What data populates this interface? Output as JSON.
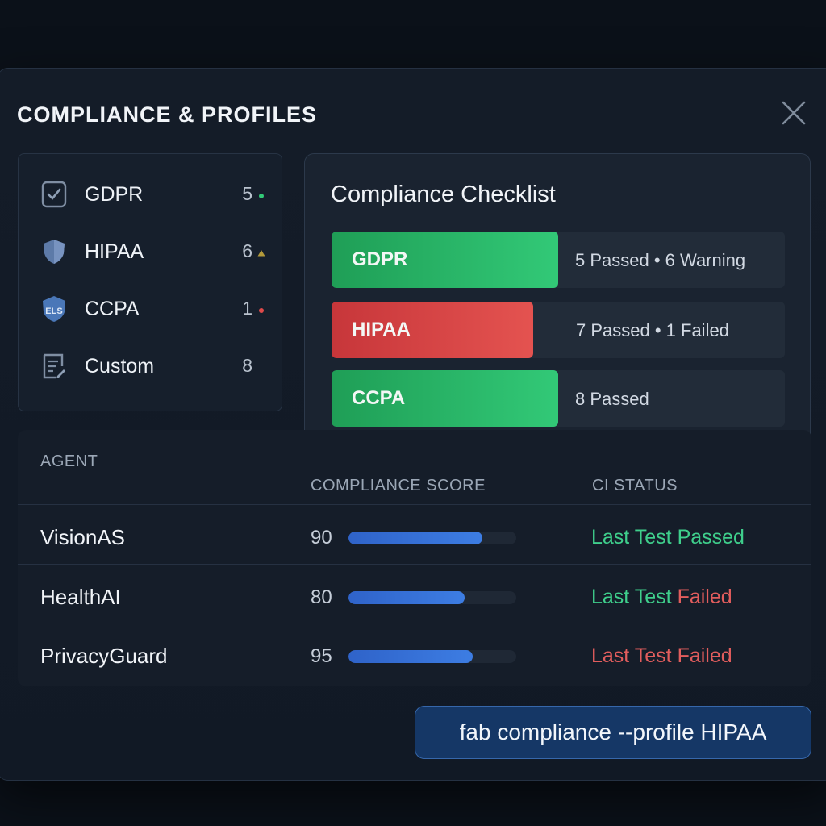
{
  "title": "COMPLIANCE & PROFILES",
  "profiles": [
    {
      "label": "GDPR",
      "count": "5",
      "icon": "checklist-shield-icon",
      "marker": "green-dot"
    },
    {
      "label": "HIPAA",
      "count": "6",
      "icon": "shield-icon",
      "marker": "warning-triangle"
    },
    {
      "label": "CCPA",
      "count": "1",
      "icon": "els-badge-icon",
      "icon_text": "ELS",
      "marker": "red-dot"
    },
    {
      "label": "Custom",
      "count": "8",
      "icon": "document-edit-icon",
      "marker": ""
    }
  ],
  "checklist": {
    "title": "Compliance Checklist",
    "items": [
      {
        "name": "GDPR",
        "detail": "5 Passed • 6 Warning",
        "status_color": "#2bb86a",
        "progress_fraction": 0.5
      },
      {
        "name": "HIPAA",
        "detail": "7 Passed • 1 Failed",
        "status_color": "#d9443f",
        "progress_fraction": 0.445
      },
      {
        "name": "CCPA",
        "detail": "8 Passed",
        "status_color": "#2bb86a",
        "progress_fraction": 0.5
      }
    ]
  },
  "agents_table": {
    "columns": {
      "agent": "AGENT",
      "score": "COMPLIANCE SCORE",
      "ci": "CI STATUS"
    },
    "rows": [
      {
        "agent": "VisionAS",
        "score": "90",
        "score_fraction": 0.8,
        "ci_prefix": "Last Test",
        "ci_result": "Passed",
        "prefix_color": "#3fcf8c",
        "result_color": "#3fcf8c"
      },
      {
        "agent": "HealthAI",
        "score": "80",
        "score_fraction": 0.69,
        "ci_prefix": "Last Test",
        "ci_result": "Failed",
        "prefix_color": "#3fcf8c",
        "result_color": "#e25d5d"
      },
      {
        "agent": "PrivacyGuard",
        "score": "95",
        "score_fraction": 0.74,
        "ci_prefix": "Last Test",
        "ci_result": "Failed",
        "prefix_color": "#e25d5d",
        "result_color": "#e25d5d"
      }
    ]
  },
  "command": "fab compliance --profile HIPAA",
  "colors": {
    "accent_blue": "#3d7de3",
    "success": "#3fcf8c",
    "danger": "#e25d5d",
    "warning": "#c8a43a"
  }
}
